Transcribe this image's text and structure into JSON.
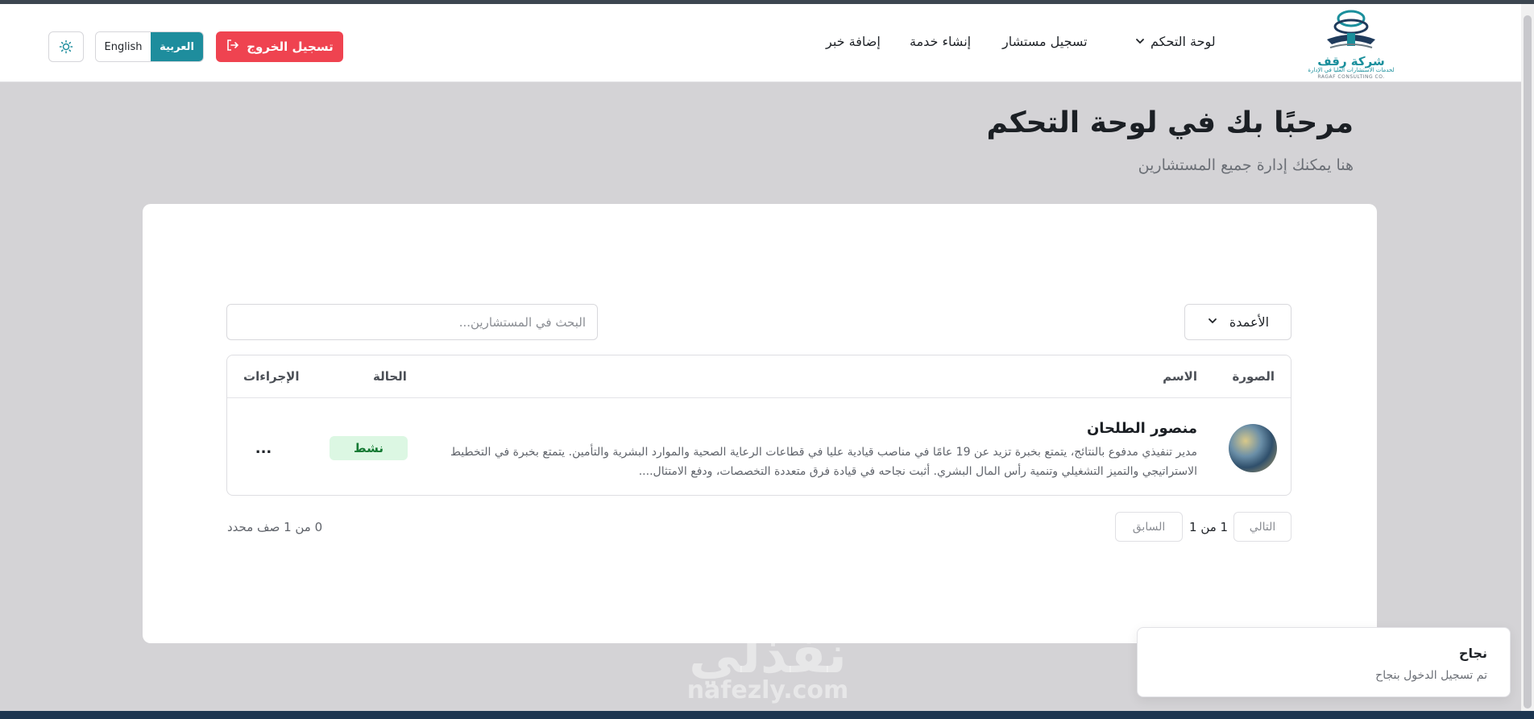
{
  "brand": {
    "name": "شركة رقف",
    "tagline": "لخدمات الاستشارات العليا في الإدارة",
    "name_en": "RAGAF CONSULTING CO."
  },
  "nav": {
    "dashboard": "لوحة التحكم",
    "register_consultant": "تسجيل مستشار",
    "create_service": "إنشاء خدمة",
    "add_news": "إضافة خبر"
  },
  "header": {
    "logout": "تسجيل الخروج",
    "lang_ar": "العربية",
    "lang_en": "English"
  },
  "page": {
    "title": "مرحبًا بك في لوحة التحكم",
    "subtitle": "هنا يمكنك إدارة جميع المستشارين"
  },
  "toolbar": {
    "columns_label": "الأعمدة",
    "search_placeholder": "البحث في المستشارين..."
  },
  "table": {
    "headers": {
      "image": "الصورة",
      "name": "الاسم",
      "status": "الحالة",
      "actions": "الإجراءات"
    },
    "rows": [
      {
        "name": "منصور الطلحان",
        "description": "مدير تنفيذي مدفوع بالنتائج، يتمتع بخبرة تزيد عن 19 عامًا في مناصب قيادية عليا في قطاعات الرعاية الصحية والموارد البشرية والتأمين. يتمتع بخبرة في التخطيط الاستراتيجي والتميز التشغيلي وتنمية رأس المال البشري. أثبت نجاحه في قيادة فرق متعددة التخصصات، ودفع الامتثال....",
        "status": "نشط",
        "actions": "..."
      }
    ]
  },
  "pagination": {
    "next": "التالي",
    "info": "1 من 1",
    "prev": "السابق",
    "selected": "0 من 1 صف محدد"
  },
  "watermark": {
    "ar": "نفذلي",
    "lat": "nafezly.com"
  },
  "toast": {
    "title": "نجاح",
    "message": "تم تسجيل الدخول بنجاح"
  },
  "colors": {
    "accent": "#1e8d9d",
    "danger": "#ef4350",
    "success_bg": "#dcf7e3",
    "success_text": "#157a34"
  }
}
